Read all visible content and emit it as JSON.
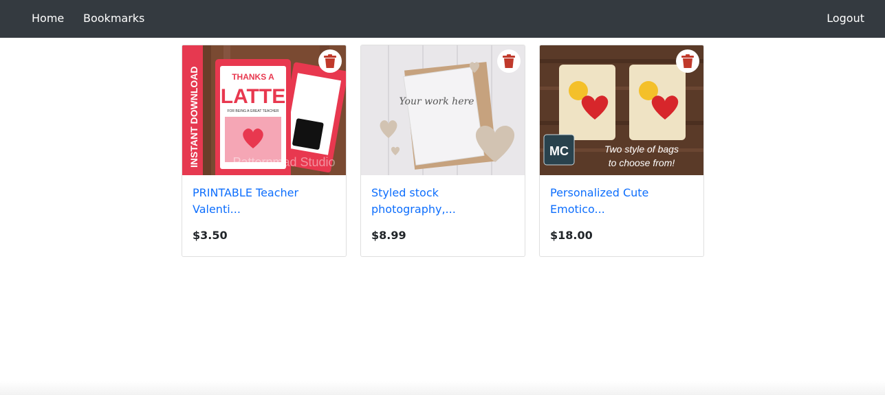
{
  "navbar": {
    "home_label": "Home",
    "bookmarks_label": "Bookmarks",
    "logout_label": "Logout",
    "background_color": "#343a40"
  },
  "cards": [
    {
      "title": "PRINTABLE Teacher Valenti...",
      "price": "$3.50",
      "image_text": {
        "side_banner": "INSTANT DOWNLOAD",
        "line1": "THANKS A",
        "line2": "LATTE",
        "line3": "FOR BEING A GREAT TEACHER",
        "watermark": "Patternmad Studio"
      },
      "delete_icon": "trash-icon"
    },
    {
      "title": "Styled stock photography,...",
      "price": "$8.99",
      "image_text": {
        "card_text": "Your work here"
      },
      "delete_icon": "trash-icon"
    },
    {
      "title": "Personalized Cute Emotico...",
      "price": "$18.00",
      "image_text": {
        "caption_line1": "Two style of bags",
        "caption_line2": "to choose from!",
        "logo": "MC"
      },
      "delete_icon": "trash-icon"
    }
  ],
  "colors": {
    "link": "#0d6efd",
    "trash": "#c0392b"
  }
}
